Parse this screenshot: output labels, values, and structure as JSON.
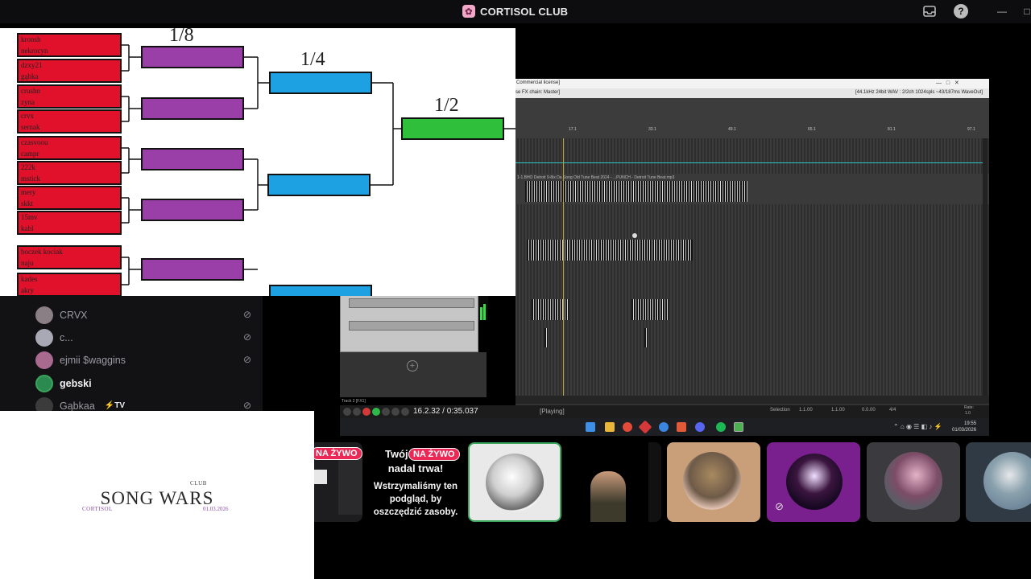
{
  "app": {
    "title": "CORTISOL CLUB",
    "inbox_icon": "inbox-icon",
    "help_icon": "help-icon",
    "help_glyph": "?",
    "minimize_glyph": "—",
    "maximize_glyph": "□"
  },
  "bracket": {
    "round_labels": [
      "1/8",
      "1/4",
      "1/2"
    ],
    "players": [
      "kronsh",
      "nekrocyn",
      "dzxy21",
      "gąbka",
      "crushn",
      "zyna",
      "crvx",
      "sernak",
      "czasvoou",
      "campr",
      "222k",
      "mstick",
      "mery",
      "skkt",
      "15mv",
      "kabl",
      "boczek kociak",
      "naju",
      "kades",
      "akry"
    ],
    "colors": {
      "first_round": "#e2112b",
      "eighth": "#9a3ea8",
      "quarter": "#1ea1e3",
      "semi": "#2fbf3a"
    }
  },
  "voice_list": {
    "members": [
      {
        "name": "CRVX",
        "muted": true,
        "active": false
      },
      {
        "name": "c...",
        "muted": true,
        "active": false
      },
      {
        "name": "ejmii $waggins",
        "muted": true,
        "active": false
      },
      {
        "name": "gebski",
        "muted": false,
        "active": true
      },
      {
        "name": "Gąbkaa",
        "muted": true,
        "active": false,
        "badge": "TV"
      }
    ],
    "mute_icon": "mic-muted-icon",
    "mute_glyph": "⊘"
  },
  "song_wars": {
    "title": "SONG WARS",
    "club": "CLUB",
    "brand": "CORTISOL",
    "date": "01.03.2026"
  },
  "daw": {
    "window_title": "Commercial license]",
    "fx_chain": "se FX chain: Master]",
    "audio_info": "[44.1kHz 24bit WAV : 2/2ch 1024spls ~43/187ms WaveOut]",
    "ruler_marks": [
      "17.1",
      "33.1",
      "49.1",
      "65.1",
      "81.1",
      "97.1"
    ],
    "clip_name": "1-1.BHO Detroit 9-8ix Da Song Old Tune Beat 2024 - ...PUNCH - Detroit Tune Beat.mp3",
    "track_label": "Track 2 [FX1]",
    "time_display": "16.2.32 / 0:35.037",
    "status": "[Playing]",
    "selection_label": "Selection",
    "selection_values": [
      "1.1.00",
      "1.1.00",
      "0.0.00"
    ],
    "time_sig": "4/4",
    "rate_label": "Rate:",
    "rate_value": "1.0",
    "clock_time": "19:55",
    "clock_date": "01/03/2026"
  },
  "tiles": {
    "live_badge": "NA ŻYWO",
    "paused_title": "Twój",
    "paused_title2": "nadal trwa!",
    "paused_body": "Wstrzymaliśmy ten podgląd, by oszczędzić zasoby."
  }
}
